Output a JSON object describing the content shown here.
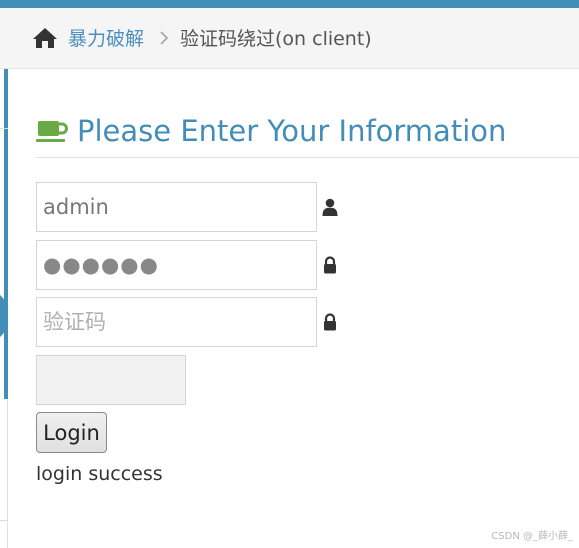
{
  "breadcrumbs": {
    "home_icon": "home-icon",
    "link_label": "暴力破解",
    "separator_icon": "chevron-right-icon",
    "current_label": "验证码绕过(on client)"
  },
  "page_header": {
    "icon": "coffee-icon",
    "title": "Please Enter Your Information"
  },
  "form": {
    "username": {
      "value": "admin",
      "icon": "user-icon"
    },
    "password": {
      "value": "●●●●●●",
      "icon": "lock-icon"
    },
    "captcha": {
      "value": "",
      "placeholder": "验证码",
      "icon": "lock-icon"
    },
    "captcha_image": "",
    "login_label": "Login"
  },
  "status": "login success",
  "watermark": "CSDN @_薛小薛_",
  "colors": {
    "accent": "#438eb9",
    "link": "#4c8fbd",
    "coffee_icon": "#69aa46",
    "breadcrumb_bg": "#f5f5f5"
  }
}
